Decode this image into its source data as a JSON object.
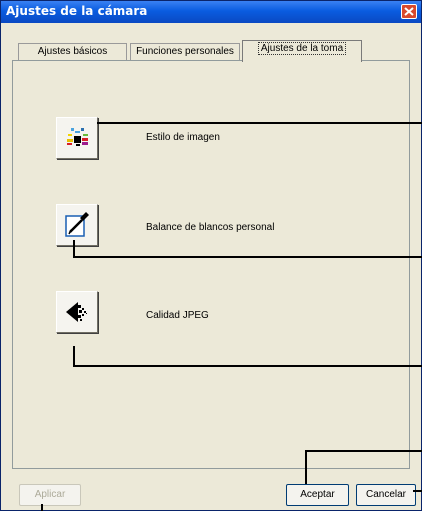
{
  "window": {
    "title": "Ajustes de la cámara"
  },
  "tabs": [
    {
      "label": "Ajustes básicos"
    },
    {
      "label": "Funciones personales"
    },
    {
      "label": "Ajustes de la toma"
    }
  ],
  "options": [
    {
      "label": "Estilo de imagen",
      "icon": "picture-style-icon"
    },
    {
      "label": "Balance de blancos personal",
      "icon": "white-balance-dropper-icon"
    },
    {
      "label": "Calidad JPEG",
      "icon": "jpeg-quality-icon"
    }
  ],
  "buttons": {
    "apply": "Aplicar",
    "ok": "Aceptar",
    "cancel": "Cancelar"
  }
}
